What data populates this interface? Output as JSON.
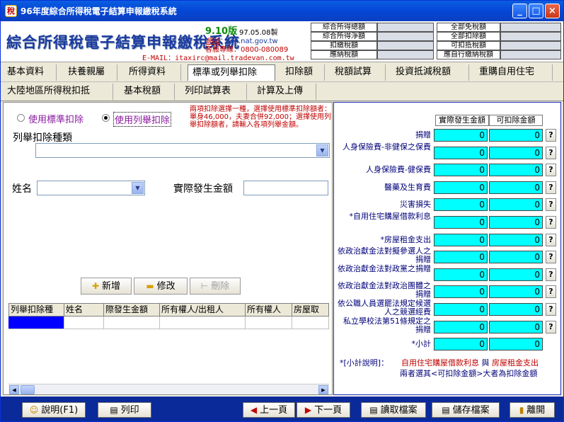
{
  "window": {
    "icon_glyph": "稅",
    "title": "96年度綜合所得稅電子結算申報繳稅系統",
    "btn_min": "_",
    "btn_max": "□",
    "btn_close": "×"
  },
  "header": {
    "system_title": "綜合所得稅電子結算申報繳稅系統",
    "version": "9.10版",
    "version_date": "97.05.08製",
    "website_label": "網址",
    "website_url": "：tax.nat.gov.tw",
    "hotline": "客服專線：0800-080089",
    "email": "E-MAIL：itaxirc@mail.tradevan.com.tw",
    "summary": {
      "labels_left": [
        "綜合所得總額",
        "綜合所得淨額",
        "扣繳稅額",
        "應納稅額"
      ],
      "labels_right": [
        "全部免稅額",
        "全部扣除額",
        "可扣抵稅額",
        "應自行繳納稅額"
      ],
      "values_masked": true
    }
  },
  "menu": {
    "row1": [
      "基本資料",
      "扶養親屬",
      "所得資料",
      "標準或列舉扣除",
      "扣除額",
      "稅額試算",
      "投資抵減稅額",
      "重購自用住宅"
    ],
    "row2": [
      "大陸地區所得稅扣抵",
      "基本稅額",
      "列印試算表",
      "計算及上傳"
    ],
    "active": "標準或列舉扣除"
  },
  "left": {
    "radio_standard": "使用標準扣除",
    "radio_itemized": "使用列舉扣除",
    "selected": "使用列舉扣除",
    "notice": "兩項扣除選擇一種，選擇使用標準扣除額者：單身46,000，夫妻合併92,000；選擇使用列舉扣除額者，請輸入各項列舉金額。",
    "deduct_type_label": "列舉扣除種類",
    "deduct_type_value": "",
    "name_label": "姓名",
    "name_value": "",
    "amount_label": "實際發生金額",
    "amount_value": "",
    "buttons": {
      "add": "新增",
      "edit": "修改",
      "delete": "刪除",
      "add_icon": "✚",
      "edit_icon": "▬",
      "delete_icon": "⊢"
    },
    "grid_columns": [
      "列舉扣除種",
      "姓名",
      "際發生金額",
      "所有權人/出租人",
      "所有權人",
      "房屋取"
    ]
  },
  "right": {
    "col_actual": "實際發生金額",
    "col_deductible": "可扣除金額",
    "rows": [
      {
        "label": "捐贈",
        "actual": "0",
        "deductible": "0"
      },
      {
        "label": "人身保險費-非健保之保費",
        "actual": "0",
        "deductible": "0"
      },
      {
        "label": "人身保險費-健保費",
        "actual": "0",
        "deductible": "0"
      },
      {
        "label": "醫藥及生育費",
        "actual": "0",
        "deductible": "0"
      },
      {
        "label": "災害損失",
        "actual": "0",
        "deductible": "0"
      },
      {
        "label": "*自用住宅購屋借款利息",
        "actual": "0",
        "deductible": "0"
      },
      {
        "label": "*房屋租金支出",
        "actual": "0",
        "deductible": "0"
      },
      {
        "label": "依政治獻金法對擬參選人之捐贈",
        "actual": "0",
        "deductible": "0"
      },
      {
        "label": "依政治獻金法對政黨之捐贈",
        "actual": "0",
        "deductible": "0"
      },
      {
        "label": "依政治獻金法對政治團體之捐贈",
        "actual": "0",
        "deductible": "0"
      },
      {
        "label": "依公職人員選罷法規定候選人之競選經費",
        "actual": "0",
        "deductible": "0"
      },
      {
        "label": "私立學校法第51條規定之捐贈",
        "actual": "0",
        "deductible": "0"
      }
    ],
    "subtotal_label": "*小計",
    "subtotal_actual": "0",
    "subtotal_deductible": "0",
    "help_glyph": "?",
    "note_title": "*[小計說明]：",
    "note_item1": "自用住宅購屋借款利息",
    "note_and": "與",
    "note_item2": "房屋租金支出",
    "note_line2": "兩者選其<可扣除金額>大者為扣除金額"
  },
  "bottom": {
    "help": "說明(F1)",
    "print": "列印",
    "prev": "上一頁",
    "next": "下一頁",
    "load": "讀取檔案",
    "save": "儲存檔案",
    "exit": "離開",
    "help_icon": "☺",
    "print_icon": "▤",
    "prev_icon": "◀",
    "next_icon": "▶",
    "load_icon": "▤",
    "save_icon": "▤",
    "exit_icon": "▮"
  },
  "colors": {
    "titlebar": "#0548d8",
    "accent_cyan": "#00ffff",
    "status_bar": "#0a2a9a",
    "warning_red": "#c00000"
  }
}
